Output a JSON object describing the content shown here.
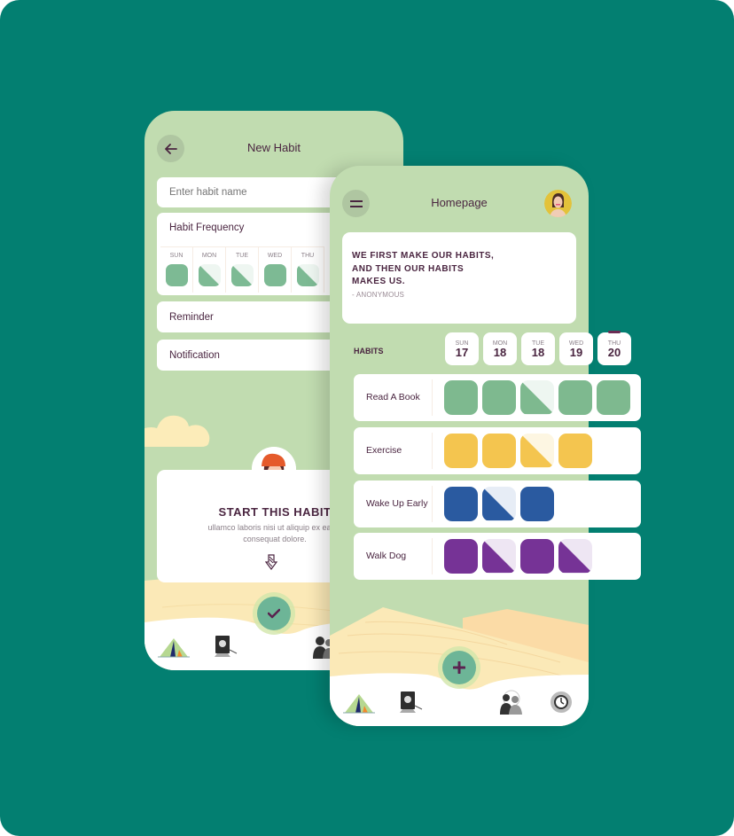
{
  "left_screen": {
    "header": {
      "title": "New Habit",
      "back_icon": "arrow-left-icon"
    },
    "habit_name_input": {
      "value": "",
      "placeholder": "Enter habit name"
    },
    "frequency": {
      "label": "Habit Frequency",
      "days": [
        {
          "name": "SUN",
          "state": "full"
        },
        {
          "name": "MON",
          "state": "half"
        },
        {
          "name": "TUE",
          "state": "half"
        },
        {
          "name": "WED",
          "state": "full"
        },
        {
          "name": "THU",
          "state": "half"
        }
      ],
      "color": "#7dba94"
    },
    "reminder": {
      "label": "Reminder"
    },
    "notification": {
      "label": "Notification"
    },
    "start_card": {
      "title": "START THIS HABIT",
      "description_line1": "ullamco laboris nisi ut aliquip ex ea co",
      "description_line2": "consequat dolore.",
      "arrow_icon": "arrow-down-icon"
    },
    "fab": {
      "icon": "check-icon"
    },
    "tabbar": [
      "tent-icon",
      "board-icon",
      "people-icon"
    ]
  },
  "right_screen": {
    "header": {
      "title": "Homepage",
      "menu_icon": "menu-icon",
      "avatar": "user-avatar"
    },
    "quote": {
      "line1": "WE FIRST MAKE OUR HABITS,",
      "line2": "AND THEN OUR HABITS",
      "line3": "MAKES US.",
      "author": "- ANONYMOUS"
    },
    "habits_label": "HABITS",
    "dates": [
      {
        "day": "SUN",
        "date": "17",
        "today": false
      },
      {
        "day": "MON",
        "date": "18",
        "today": false
      },
      {
        "day": "TUE",
        "date": "18",
        "today": false
      },
      {
        "day": "WED",
        "date": "19",
        "today": false
      },
      {
        "day": "THU",
        "date": "20",
        "today": true
      }
    ],
    "habits": [
      {
        "name": "Read A Book",
        "color": "#7eb98f",
        "light": "#eef6f1",
        "states": [
          "full",
          "full",
          "half",
          "full",
          "full"
        ]
      },
      {
        "name": "Exercise",
        "color": "#f4c54f",
        "light": "#fdf6e2",
        "states": [
          "full",
          "full",
          "half",
          "full"
        ]
      },
      {
        "name": "Wake Up Early",
        "color": "#2a5aa0",
        "light": "#e7edf6",
        "states": [
          "full",
          "half",
          "full"
        ]
      },
      {
        "name": "Walk Dog",
        "color": "#763396",
        "light": "#eee6f3",
        "states": [
          "full",
          "half",
          "full",
          "half"
        ]
      }
    ],
    "fab": {
      "icon": "plus-icon"
    },
    "tabbar": [
      "tent-icon",
      "board-icon",
      "people-icon",
      "settings-icon"
    ]
  },
  "colors": {
    "background": "#037f71",
    "phone_bg": "#c1dcb0",
    "text_primary": "#4a2540",
    "fab": "#6db597",
    "sand": "#fbeab5"
  }
}
